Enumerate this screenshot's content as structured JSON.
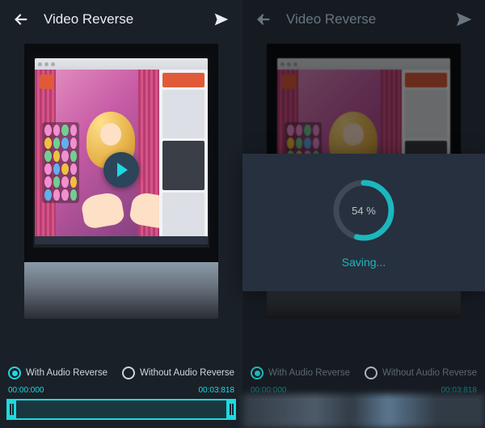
{
  "colors": {
    "accent": "#1fd8e0",
    "bg": "#1a2028",
    "modal": "#2e3949"
  },
  "left": {
    "header": {
      "title": "Video Reverse"
    },
    "options": {
      "with_audio": "With Audio Reverse",
      "without_audio": "Without Audio  Reverse",
      "selected": "with_audio"
    },
    "timeline": {
      "start": "00:00:000",
      "end": "00:03:818"
    }
  },
  "right": {
    "header": {
      "title": "Video Reverse"
    },
    "options": {
      "with_audio": "With Audio Reverse",
      "without_audio": "Without Audio  Reverse",
      "selected": "with_audio"
    },
    "timeline": {
      "start": "00:00:000",
      "end": "00:03:818"
    },
    "modal": {
      "percent": "54 %",
      "status": "Saving..."
    },
    "progress_value": 54
  }
}
